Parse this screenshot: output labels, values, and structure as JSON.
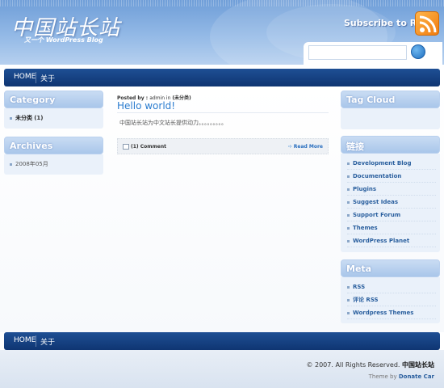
{
  "header": {
    "site_title": "中国站长站",
    "site_subtitle": "又一个 WordPress Blog",
    "subscribe_label": "Subscribe to Rss :",
    "search_placeholder": ""
  },
  "nav": {
    "items": [
      {
        "label": "HOME"
      },
      {
        "label": "关于"
      }
    ]
  },
  "left_sidebar": {
    "category": {
      "title": "Category",
      "items": [
        {
          "label": "未分类",
          "count": "(1)"
        }
      ]
    },
    "archives": {
      "title": "Archives",
      "items": [
        {
          "label": "2008年05月"
        }
      ]
    }
  },
  "post": {
    "meta_prefix": "Posted by : ",
    "author": "admin",
    "meta_in": " in ",
    "category": "(未分类)",
    "title": "Hello world!",
    "excerpt": "中国站长站为中文站长提供动力。。。。。。。。。",
    "comments": "(1) Comment",
    "read_more": "Read More"
  },
  "right_sidebar": {
    "tag_cloud": {
      "title": "Tag Cloud"
    },
    "links": {
      "title": "链接",
      "items": [
        {
          "label": "Development Blog"
        },
        {
          "label": "Documentation"
        },
        {
          "label": "Plugins"
        },
        {
          "label": "Suggest Ideas"
        },
        {
          "label": "Support Forum"
        },
        {
          "label": "Themes"
        },
        {
          "label": "WordPress Planet"
        }
      ]
    },
    "meta": {
      "title": "Meta",
      "items": [
        {
          "label": "RSS"
        },
        {
          "label": "评论 RSS"
        },
        {
          "label": "Wordpress Themes"
        }
      ]
    }
  },
  "footer": {
    "copyright_prefix": "© 2007. All Rights Reserved. ",
    "copyright_site": "中国站长站",
    "theme_prefix": "Theme by ",
    "theme_author": "Donate Car"
  },
  "colors": {
    "header": "#93b9e6",
    "nav": "#0f3572",
    "link": "#2a5f9e",
    "rss": "#f07c10"
  },
  "icons": [
    "rss-feed-icon",
    "search-go-icon",
    "comment-icon",
    "read-more-arrow-icon"
  ]
}
